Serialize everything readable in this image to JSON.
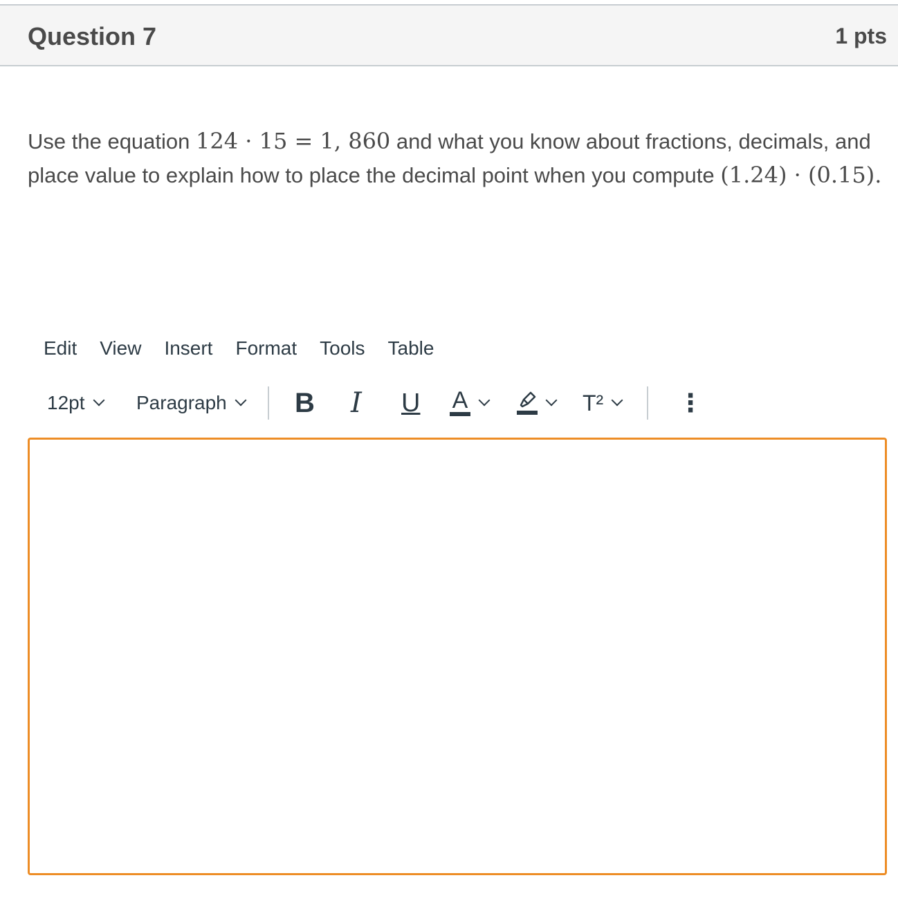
{
  "header": {
    "title": "Question 7",
    "points": "1 pts"
  },
  "question": {
    "part1": "Use the equation",
    "math1": "124 · 15  =  1, 860",
    "part2": "and what you know about fractions, decimals, and place value to explain how to place the decimal point when you compute",
    "math2": "(1.24) · (0.15)",
    "part3": "."
  },
  "editor": {
    "menu": [
      "Edit",
      "View",
      "Insert",
      "Format",
      "Tools",
      "Table"
    ],
    "font_size": "12pt",
    "block_format": "Paragraph",
    "bold": "B",
    "italic": "I",
    "underline": "U",
    "text_color": "A",
    "superscript": "T²",
    "more": "⋮",
    "focus_color": "#ed8d26"
  }
}
